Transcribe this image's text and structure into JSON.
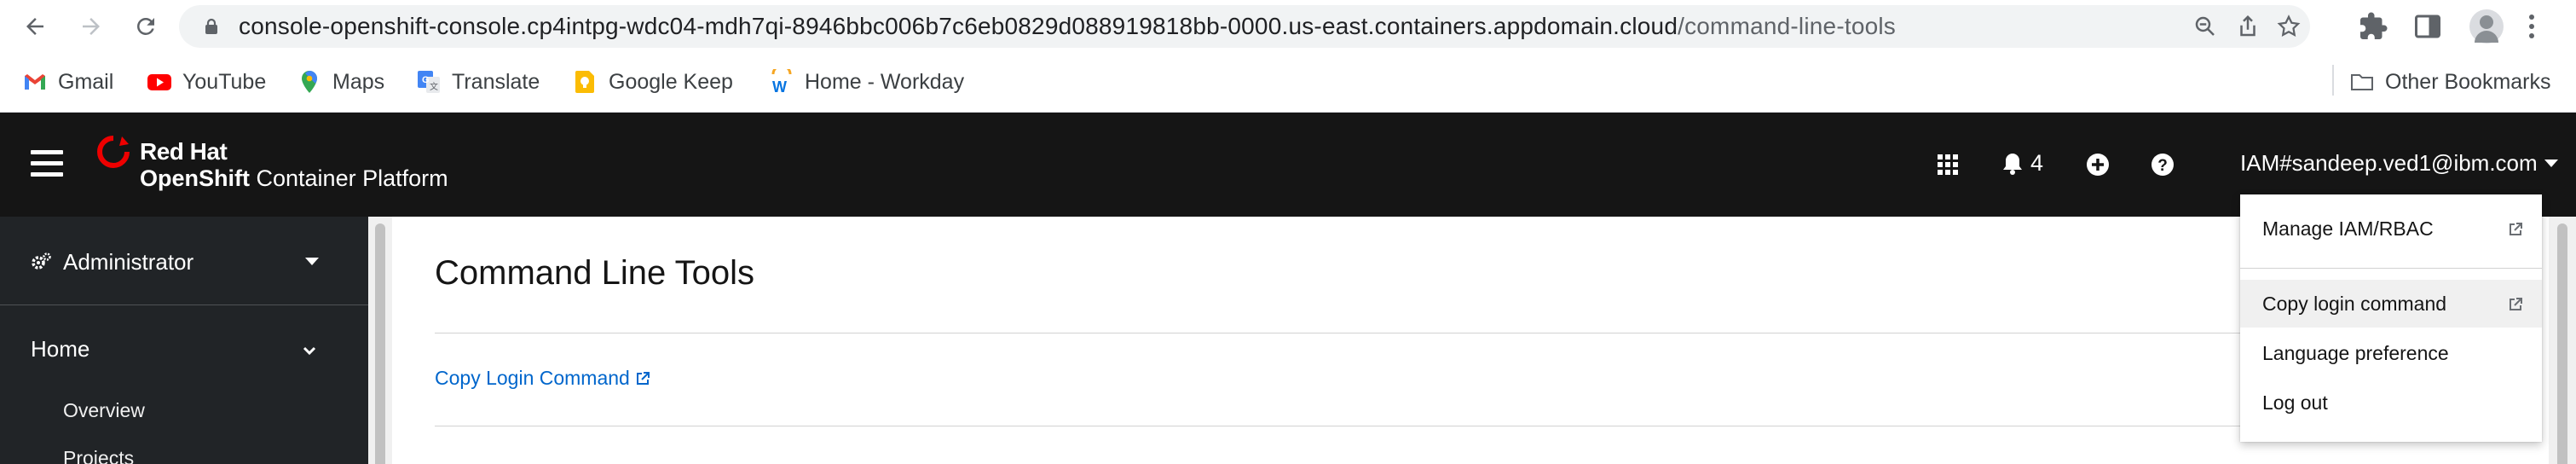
{
  "browser": {
    "url_host": "console-openshift-console.cp4intpg-wdc04-mdh7qi-8946bbc006b7c6eb0829d088919818bb-0000.us-east.containers.appdomain.cloud",
    "url_path": "/command-line-tools"
  },
  "bookmarks": {
    "items": [
      {
        "label": "Gmail",
        "icon": "gmail-icon"
      },
      {
        "label": "YouTube",
        "icon": "youtube-icon"
      },
      {
        "label": "Maps",
        "icon": "maps-icon"
      },
      {
        "label": "Translate",
        "icon": "translate-icon"
      },
      {
        "label": "Google Keep",
        "icon": "keep-icon"
      },
      {
        "label": "Home - Workday",
        "icon": "workday-icon"
      }
    ],
    "other": "Other Bookmarks"
  },
  "masthead": {
    "brand_line1": "Red Hat",
    "brand_line2_bold": "OpenShift",
    "brand_line2_rest": " Container Platform",
    "notification_count": "4",
    "user": "IAM#sandeep.ved1@ibm.com"
  },
  "sidebar": {
    "perspective": "Administrator",
    "section": "Home",
    "items": [
      "Overview",
      "Projects"
    ]
  },
  "main": {
    "title": "Command Line Tools",
    "copy_login_link": "Copy Login Command"
  },
  "user_menu": {
    "items": [
      "Manage IAM/RBAC",
      "Copy login command",
      "Language preference",
      "Log out"
    ]
  },
  "colors": {
    "masthead": "#151515",
    "sidebar": "#212427",
    "link": "#0066cc",
    "redhat": "#ee0000"
  }
}
